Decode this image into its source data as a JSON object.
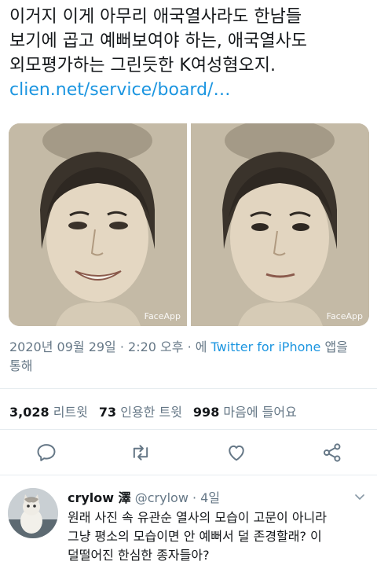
{
  "tweet": {
    "text_lines": [
      "이거지 이게 아무리 애국열사라도 한남들",
      "보기에 곱고 예뻐보여야 하는, 애국열사도",
      "외모평가하는 그린듯한 K여성혐오지."
    ],
    "link_text": "clien.net/service/board/…",
    "media_watermark": "FaceApp",
    "timestamp": "2020년 09월 29일 · 2:20 오후 · 에 ",
    "source": "Twitter for iPhone",
    "source_suffix": " 앱을",
    "timestamp_line2": "통해",
    "retweets_count": "3,028",
    "retweets_label": "리트윗",
    "quotes_count": "73",
    "quotes_label": "인용한 트윗",
    "likes_count": "998",
    "likes_label": "마음에 들어요"
  },
  "actions": [
    {
      "icon": "reply-icon"
    },
    {
      "icon": "retweet-icon"
    },
    {
      "icon": "like-icon"
    },
    {
      "icon": "share-icon"
    }
  ],
  "reply": {
    "name": "crylow 澤",
    "handle": "@crylow",
    "time": " · 4일",
    "lines": [
      "원래 사진 속 유관순 열사의 모습이 고문이 아니라",
      "그냥 평소의 모습이면 안 예뻐서 덜 존경할래? 이",
      "덜떨어진 한심한 종자들아?"
    ]
  },
  "colors": {
    "link": "#1b95e0",
    "secondary_text": "#657786",
    "divider": "#e6ecf0"
  }
}
